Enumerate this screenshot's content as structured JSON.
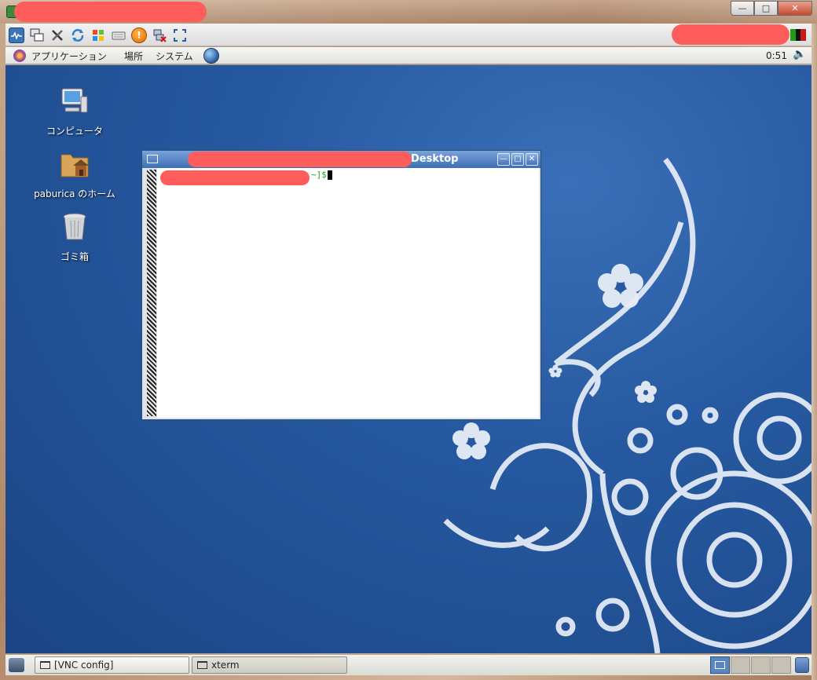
{
  "vnc_window": {
    "title": "",
    "buttons": {
      "minimize": "—",
      "maximize": "□",
      "close": "✕"
    },
    "toolbar_icons": [
      "connection-info-icon",
      "copy-icon",
      "options-tools-icon",
      "refresh-icon",
      "windows-key-icon",
      "keyboard-icon",
      "alert-icon",
      "disconnect-icon",
      "fullscreen-icon"
    ]
  },
  "top_panel": {
    "menus": [
      "アプリケーション",
      "場所",
      "システム"
    ],
    "clock": "0:51"
  },
  "desktop_icons": [
    {
      "label": "コンピュータ",
      "icon": "computer-icon"
    },
    {
      "label": "paburica のホーム",
      "icon": "home-folder-icon"
    },
    {
      "label": "ゴミ箱",
      "icon": "trash-icon"
    }
  ],
  "xterm": {
    "title": "Desktop",
    "buttons": {
      "minimize": "—",
      "maximize": "□",
      "close": "✕"
    },
    "prompt_tail": "~]$"
  },
  "taskbar": {
    "tasks": [
      {
        "label": "[VNC config]",
        "active": false
      },
      {
        "label": "xterm",
        "active": true
      }
    ],
    "workspaces": 4,
    "active_workspace": 1
  },
  "colors": {
    "desktop_blue": "#2659a0",
    "title_blue": "#3e6fb5",
    "redaction": "#ff5c5c",
    "prompt_green": "#21a021"
  }
}
